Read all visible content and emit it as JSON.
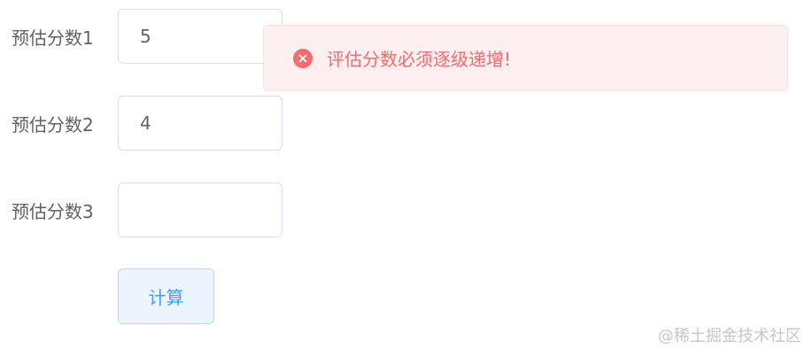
{
  "form": {
    "rows": [
      {
        "label": "预估分数1",
        "value": "5"
      },
      {
        "label": "预估分数2",
        "value": "4"
      },
      {
        "label": "预估分数3",
        "value": ""
      }
    ],
    "submit_label": "计算"
  },
  "toast": {
    "type": "error",
    "icon": "error-circle-icon",
    "message": "评估分数必须逐级递增!"
  },
  "watermark": "@稀土掘金技术社区",
  "colors": {
    "error": "#f56c6c",
    "error_bg": "#fef0f0",
    "primary": "#409eff",
    "primary_bg": "#ecf5ff",
    "text": "#5f6266",
    "border": "#dcdfe6"
  }
}
